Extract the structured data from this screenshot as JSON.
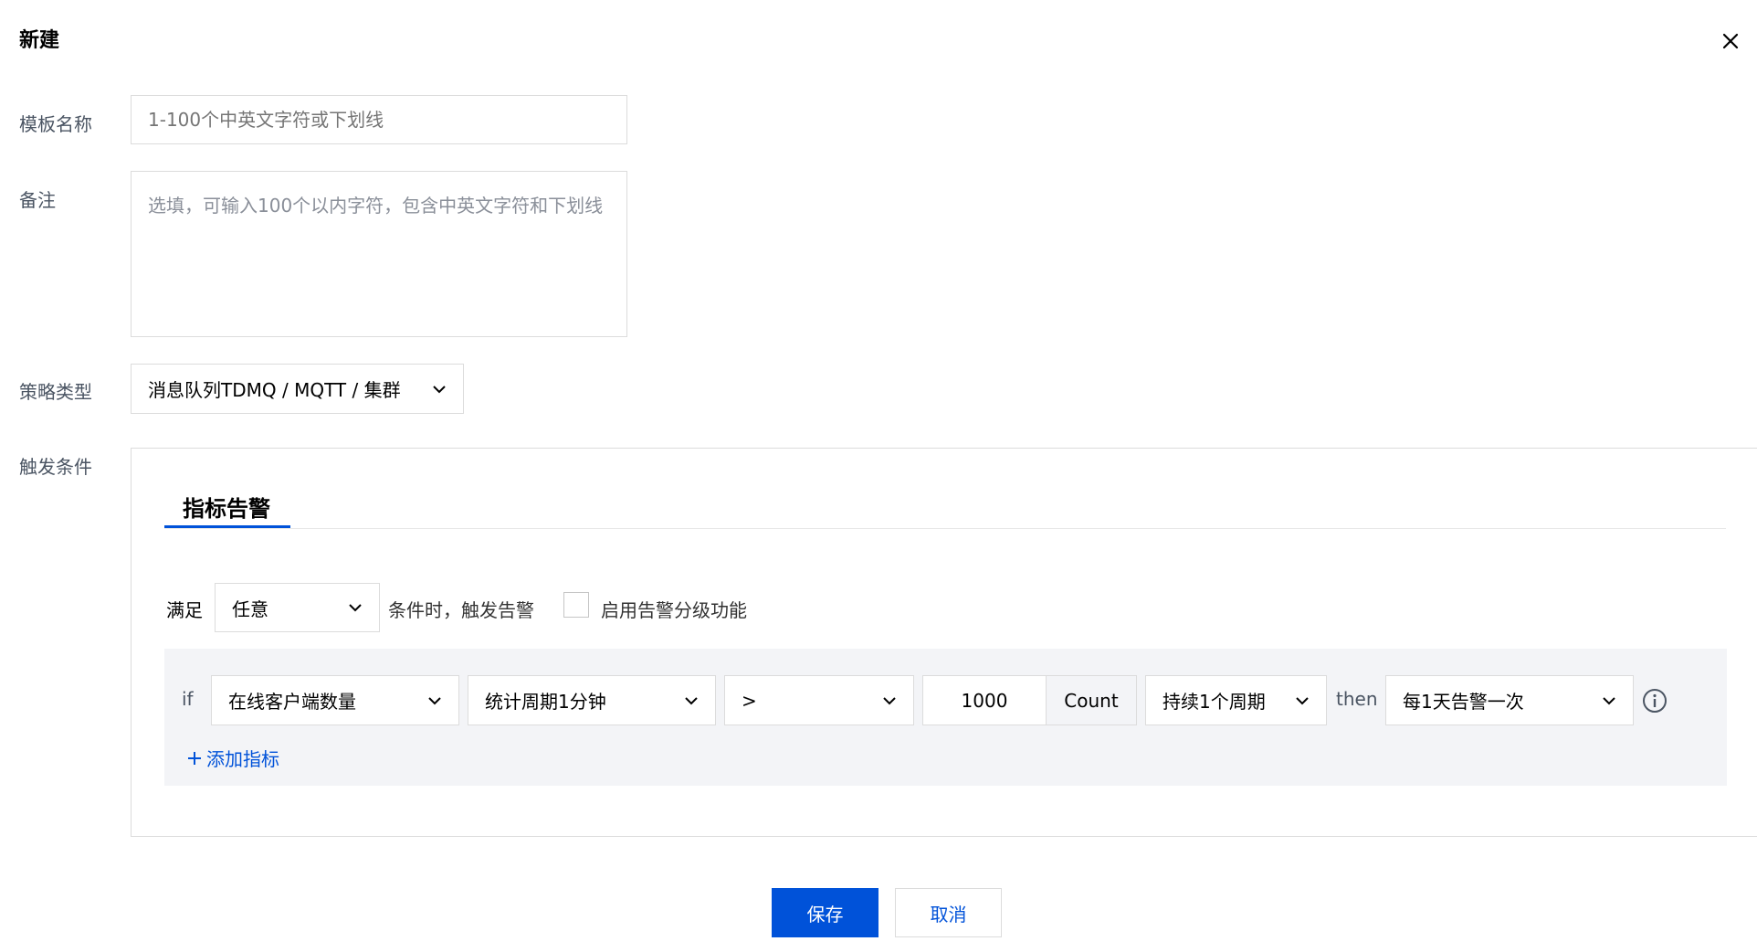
{
  "dialog": {
    "title": "新建",
    "close_icon": "close-icon"
  },
  "form": {
    "template_name": {
      "label": "模板名称",
      "placeholder": "1-100个中英文字符或下划线",
      "value": ""
    },
    "remark": {
      "label": "备注",
      "placeholder": "选填，可输入100个以内字符，包含中英文字符和下划线",
      "value": ""
    },
    "policy_type": {
      "label": "策略类型",
      "value": "消息队列TDMQ / MQTT / 集群"
    },
    "trigger": {
      "label": "触发条件",
      "tabs": [
        {
          "label": "指标告警",
          "active": true
        }
      ],
      "satisfy_label": "满足",
      "satisfy_value": "任意",
      "condition_text": "条件时，触发告警",
      "grading_checkbox": {
        "label": "启用告警分级功能",
        "checked": false
      },
      "rule": {
        "if_label": "if",
        "metric": "在线客户端数量",
        "period": "统计周期1分钟",
        "operator": ">",
        "threshold": "1000",
        "unit": "Count",
        "duration": "持续1个周期",
        "then_label": "then",
        "frequency": "每1天告警一次",
        "info_icon": "info-icon"
      },
      "add_metric": {
        "icon": "plus-icon",
        "label": "添加指标"
      }
    }
  },
  "footer": {
    "save_label": "保存",
    "cancel_label": "取消"
  },
  "colors": {
    "primary": "#0052d9",
    "border": "#dcdcdc",
    "panel_bg": "#f3f4f7"
  }
}
